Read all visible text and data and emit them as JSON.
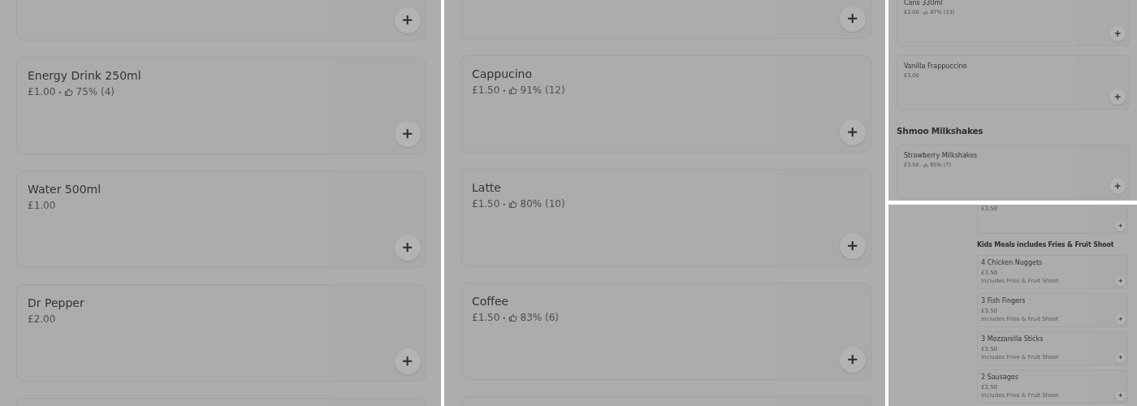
{
  "panels": [
    {
      "items": [
        {
          "kind": "item"
        },
        {
          "kind": "item",
          "name": "Energy Drink 250ml",
          "price": "£1.00",
          "rating": "75% (4)"
        },
        {
          "kind": "item",
          "name": "Water 500ml",
          "price": "£1.00"
        },
        {
          "kind": "item",
          "name": "Dr Pepper",
          "price": "£2.00"
        },
        {
          "kind": "item"
        }
      ]
    },
    {
      "items": [
        {
          "kind": "item"
        },
        {
          "kind": "item",
          "name": "Cappucino",
          "price": "£1.50",
          "rating": "91% (12)"
        },
        {
          "kind": "item",
          "name": "Latte",
          "price": "£1.50",
          "rating": "80% (10)"
        },
        {
          "kind": "item",
          "name": "Coffee",
          "price": "£1.50",
          "rating": "83% (6)"
        },
        {
          "kind": "item"
        }
      ]
    },
    {
      "items": [
        {
          "kind": "item",
          "name": "Cans 330ml",
          "price": "£2.00",
          "rating": "87% (33)"
        },
        {
          "kind": "item",
          "name": "Vanilla Frappuccino",
          "price": "£3.00"
        },
        {
          "kind": "heading",
          "name": "Shmoo Milkshakes"
        },
        {
          "kind": "item",
          "name": "Strawberry Milkshakes",
          "price": "£3.50",
          "rating": "85% (7)"
        }
      ]
    },
    {
      "items": [
        {
          "kind": "item",
          "price": "£3.50"
        },
        {
          "kind": "heading",
          "name": "Kids Meals includes Fries & Fruit Shoot"
        },
        {
          "kind": "item",
          "name": "4 Chicken Nuggets",
          "price": "£3.50",
          "description": "Includes Fries & Fruit Shoot"
        },
        {
          "kind": "item",
          "name": "3 Fish Fingers",
          "price": "£3.50",
          "description": "Includes Fries & Fruit Shoot"
        },
        {
          "kind": "item",
          "name": "3 Mozzarella Sticks",
          "price": "£3.50",
          "description": "Includes Fries & Fruit Shoot"
        },
        {
          "kind": "item",
          "name": "2 Sausages",
          "price": "£3.50",
          "description": "Includes Fries & Fruit Shoot"
        }
      ]
    }
  ]
}
